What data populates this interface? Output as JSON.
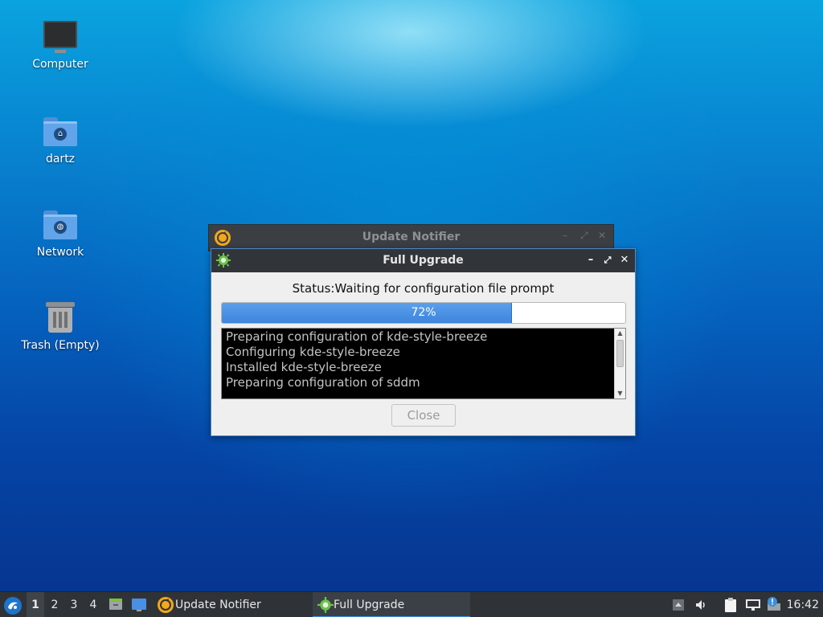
{
  "desktop": {
    "icons": [
      {
        "label": "Computer",
        "icon": "computer-icon"
      },
      {
        "label": "dartz",
        "icon": "home-folder-icon"
      },
      {
        "label": "Network",
        "icon": "network-folder-icon"
      },
      {
        "label": "Trash (Empty)",
        "icon": "trash-icon"
      }
    ]
  },
  "back_window": {
    "title": "Update Notifier",
    "controls": {
      "minimize": "–",
      "maximize": "⤢",
      "close": "✕"
    }
  },
  "dialog": {
    "title": "Full Upgrade",
    "controls": {
      "minimize": "–",
      "maximize": "⤢",
      "close": "✕"
    },
    "status": "Status:Waiting for configuration file prompt",
    "progress": {
      "value": 72,
      "label": "72%"
    },
    "log": [
      "Preparing configuration of kde-style-breeze",
      "Configuring kde-style-breeze",
      "Installed kde-style-breeze",
      "Preparing configuration of sddm"
    ],
    "close_label": "Close"
  },
  "taskbar": {
    "workspaces": [
      "1",
      "2",
      "3",
      "4"
    ],
    "active_workspace": "1",
    "tasks": [
      {
        "label": "Update Notifier",
        "active": false
      },
      {
        "label": "Full Upgrade",
        "active": true
      }
    ],
    "clock": "16:42"
  },
  "colors": {
    "accent": "#3e8ed8",
    "titlebar": "#313539",
    "progress_fill": "#4a90e2",
    "terminal_bg": "#000000"
  }
}
